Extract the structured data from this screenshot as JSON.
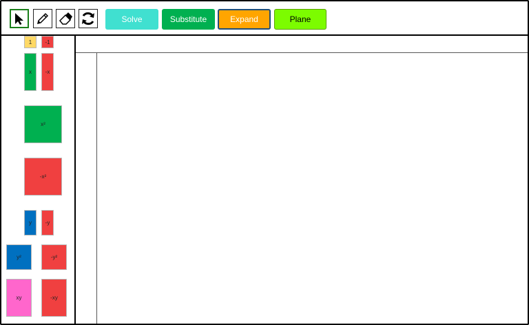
{
  "toolbar": {
    "tools": {
      "select": "pointer-icon",
      "pencil": "pencil-icon",
      "eraser": "eraser-icon",
      "reset": "refresh-icon"
    },
    "buttons": {
      "solve": {
        "label": "Solve",
        "bg": "#40e0d0",
        "color": "#ffffff"
      },
      "substitute": {
        "label": "Substitute",
        "bg": "#00b050",
        "color": "#ffffff"
      },
      "expand": {
        "label": "Expand",
        "bg": "#ffa500",
        "color": "#ffffff"
      },
      "plane": {
        "label": "Plane",
        "bg": "#7cfc00",
        "color": "#000000"
      }
    }
  },
  "palette": {
    "one": {
      "label": "1",
      "color": "#ffd966"
    },
    "neg_one": {
      "label": "-1",
      "color": "#f04040"
    },
    "x": {
      "label": "x",
      "color": "#00b050"
    },
    "neg_x": {
      "label": "-x",
      "color": "#f04040"
    },
    "x2": {
      "label": "x²",
      "color": "#00b050"
    },
    "neg_x2": {
      "label": "-x²",
      "color": "#f04040"
    },
    "y": {
      "label": "y",
      "color": "#0070c0"
    },
    "neg_y": {
      "label": "-y",
      "color": "#f04040"
    },
    "y2": {
      "label": "y²",
      "color": "#0070c0"
    },
    "neg_y2": {
      "label": "-y²",
      "color": "#f04040"
    },
    "xy": {
      "label": "xy",
      "color": "#ff66cc"
    },
    "neg_xy": {
      "label": "-xy",
      "color": "#f04040"
    }
  }
}
